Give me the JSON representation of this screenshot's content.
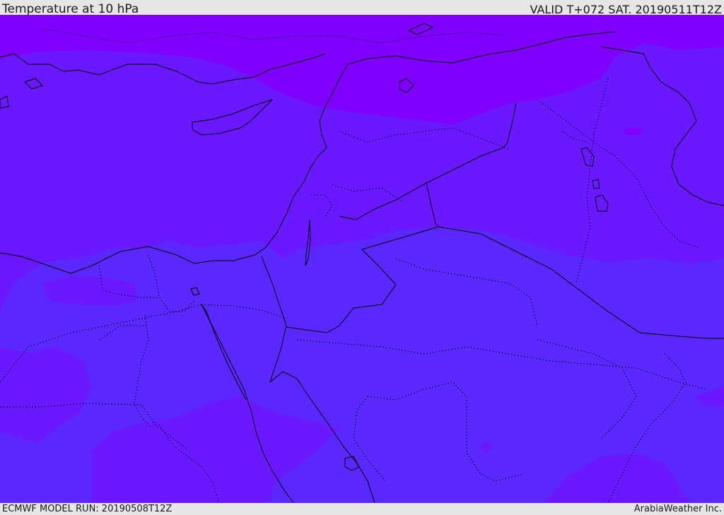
{
  "header": {
    "title": "Temperature at 10 hPa",
    "valid": "VALID T+072 SAT. 20190511T12Z"
  },
  "footer": {
    "run": "ECMWF MODEL RUN: 20190508T12Z",
    "credit": "ArabiaWeather Inc."
  },
  "map": {
    "field": "temperature",
    "level": "10 hPa",
    "colors": {
      "band_warmest": "#8000ff",
      "band_mid": "#6a18ff",
      "band_cool": "#5a28ff",
      "border": "#000000"
    }
  }
}
